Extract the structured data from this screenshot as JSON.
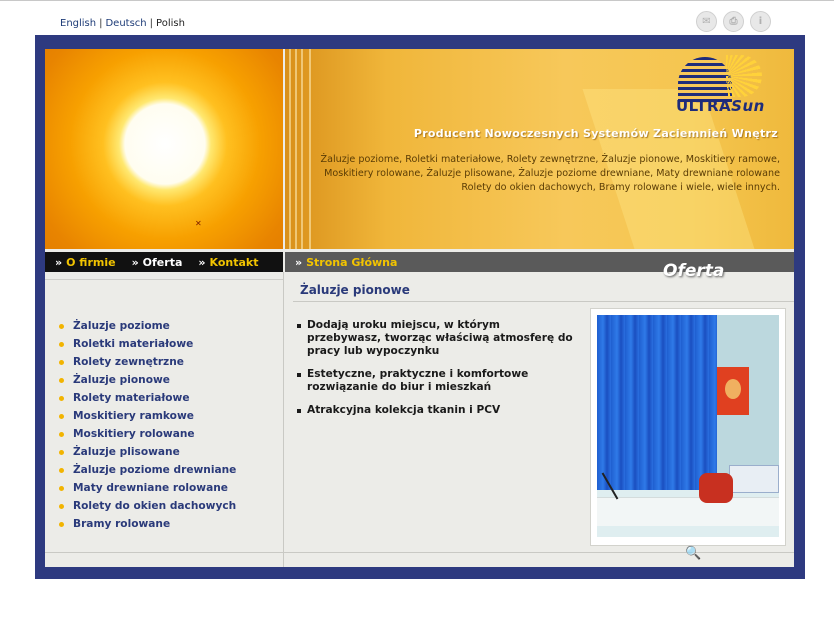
{
  "languages": {
    "english": "English",
    "deutsch": "Deutsch",
    "polish": "Polish",
    "separator": "|"
  },
  "top_icons": [
    "mail-icon",
    "print-icon",
    "info-icon"
  ],
  "banner": {
    "logo_text_main": "ULTRA",
    "logo_text_accent": "Sun",
    "tagline": "Producent Nowoczesnych Systemów Zaciemnień Wnętrz",
    "products_line1": "Żaluzje poziome, Roletki materiałowe, Rolety zewnętrzne, Żaluzje pionowe, Moskitiery ramowe,",
    "products_line2": "Moskitiery rolowane, Żaluzje plisowane, Żaluzje poziome drewniane, Maty drewniane rolowane",
    "products_line3": "Rolety do okien dachowych, Bramy rolowane i wiele, wiele innych."
  },
  "nav": {
    "arrow": "»",
    "o_firmie": "O firmie",
    "oferta": "Oferta",
    "kontakt": "Kontakt",
    "strona_glowna": "Strona Główna"
  },
  "section_badge": "Oferta",
  "sidebar": {
    "items": [
      {
        "label": "Żaluzje poziome"
      },
      {
        "label": "Roletki materiałowe"
      },
      {
        "label": "Rolety zewnętrzne"
      },
      {
        "label": "Żaluzje pionowe"
      },
      {
        "label": "Rolety materiałowe"
      },
      {
        "label": "Moskitiery ramkowe"
      },
      {
        "label": "Moskitiery rolowane"
      },
      {
        "label": "Żaluzje plisowane"
      },
      {
        "label": "Żaluzje poziome drewniane"
      },
      {
        "label": "Maty drewniane rolowane"
      },
      {
        "label": "Rolety do okien dachowych"
      },
      {
        "label": "Bramy rolowane"
      }
    ]
  },
  "content": {
    "title": "Żaluzje pionowe",
    "bullets": [
      "Dodają uroku miejscu, w którym przebywasz, tworząc właściwą atmosferę do pracy lub wypoczynku",
      "Estetyczne, praktyczne i komfortowe rozwiązanie do biur i mieszkań",
      "Atrakcyjna kolekcja tkanin i PCV"
    ]
  },
  "colors": {
    "frame": "#2e3a80",
    "accent_yellow": "#f2c400",
    "link_blue": "#2a3a7a"
  }
}
